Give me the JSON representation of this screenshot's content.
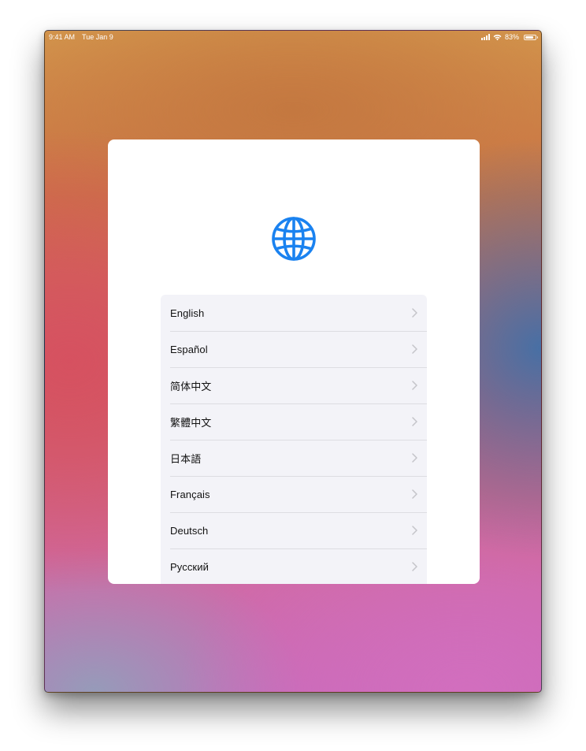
{
  "status_bar": {
    "time": "9:41 AM",
    "date": "Tue Jan 9",
    "battery_text": "83%",
    "battery_level": 0.83
  },
  "setup": {
    "icon": "globe-icon",
    "accent_color": "#1a82f0",
    "languages": [
      {
        "label": "English"
      },
      {
        "label": "Español"
      },
      {
        "label": "简体中文"
      },
      {
        "label": "繁體中文"
      },
      {
        "label": "日本語"
      },
      {
        "label": "Français"
      },
      {
        "label": "Deutsch"
      },
      {
        "label": "Русский"
      }
    ]
  }
}
